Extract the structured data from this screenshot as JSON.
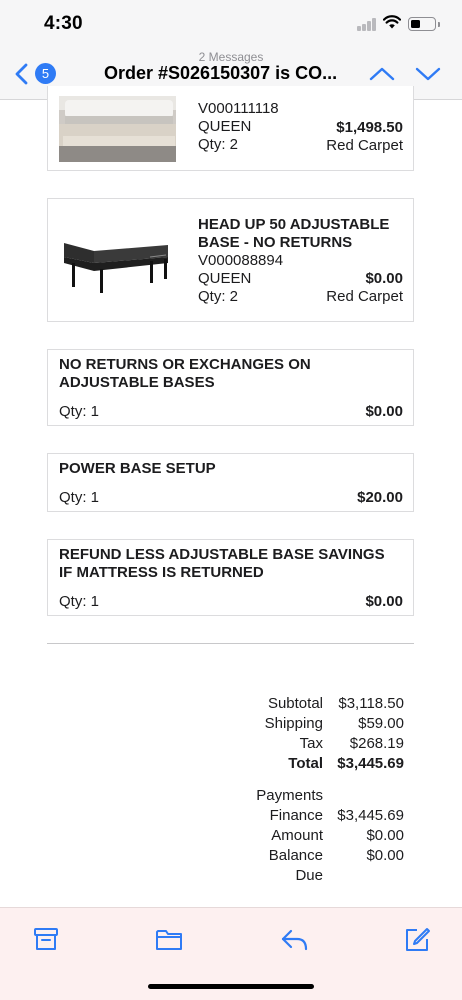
{
  "status_bar": {
    "time": "4:30"
  },
  "nav": {
    "message_count": "2 Messages",
    "back_badge": "5",
    "title": "Order #S026150307 is CO...",
    "accent_color": "#2f7bf5"
  },
  "items": [
    {
      "lines": [
        "V000111118",
        "QUEEN",
        "Qty: 2"
      ],
      "price": "$1,498.50",
      "fulfillment": "Red Carpet",
      "image": "mattress-on-bed-frame"
    },
    {
      "name_lines": [
        "HEAD UP 50 ADJUSTABLE",
        "BASE - NO RETURNS"
      ],
      "lines": [
        "V000088894",
        "QUEEN",
        "Qty: 2"
      ],
      "price": "$0.00",
      "fulfillment": "Red Carpet",
      "image": "adjustable-base"
    },
    {
      "name_lines": [
        "NO RETURNS OR EXCHANGES ON",
        "ADJUSTABLE BASES"
      ],
      "qty": "Qty: 1",
      "price": "$0.00"
    },
    {
      "name_lines": [
        "POWER BASE SETUP"
      ],
      "qty": "Qty: 1",
      "price": "$20.00"
    },
    {
      "name_lines": [
        "REFUND LESS ADJUSTABLE BASE SAVINGS",
        "IF MATTRESS IS RETURNED"
      ],
      "qty": "Qty: 1",
      "price": "$0.00"
    }
  ],
  "totals": {
    "subtotal_label": "Subtotal",
    "subtotal": "$3,118.50",
    "shipping_label": "Shipping",
    "shipping": "$59.00",
    "tax_label": "Tax",
    "tax": "$268.19",
    "total_label": "Total",
    "total": "$3,445.69"
  },
  "payments": {
    "heading": "Payments",
    "finance_label": "Finance",
    "finance": "$3,445.69",
    "amount_label": "Amount",
    "amount": "$0.00",
    "balance_label": "Balance",
    "balance": "$0.00",
    "due_label": "Due"
  },
  "toolbar": {
    "icons": [
      "archive-icon",
      "folder-icon",
      "reply-icon",
      "compose-icon"
    ],
    "icon_color": "#2f7bf5"
  }
}
